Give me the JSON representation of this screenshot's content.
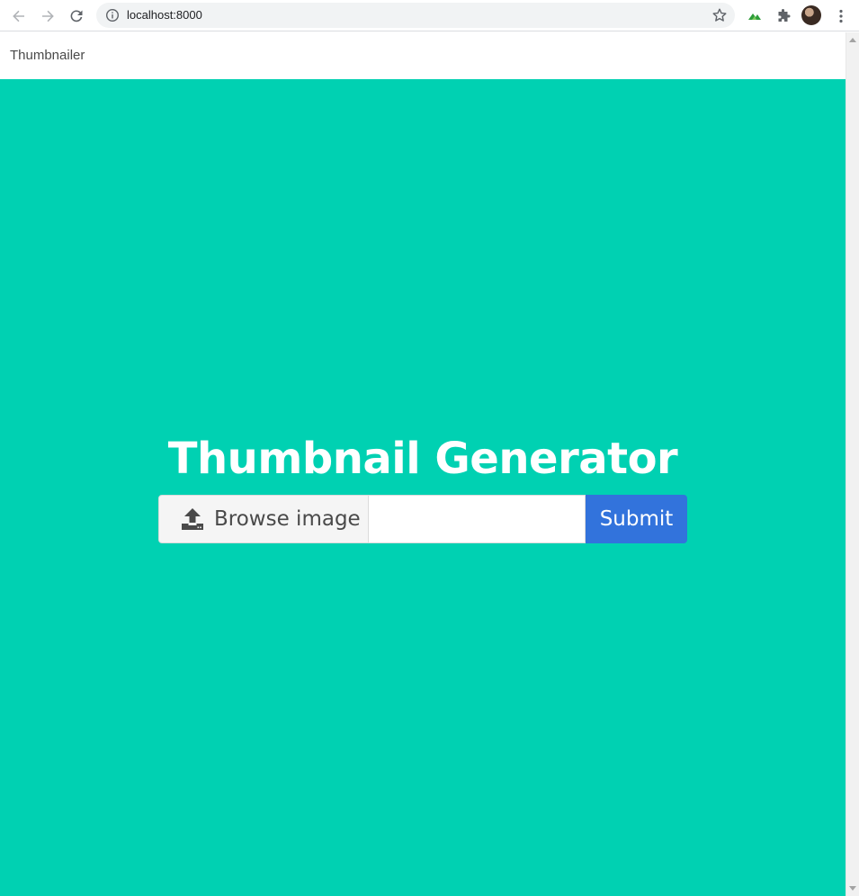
{
  "browser": {
    "url": "localhost:8000",
    "icons": [
      "back-arrow-icon",
      "forward-arrow-icon",
      "reload-icon",
      "info-icon",
      "star-icon",
      "extension-icon",
      "puzzle-icon",
      "profile-avatar",
      "menu-dots-icon"
    ]
  },
  "navbar": {
    "brand": "Thumbnailer"
  },
  "hero": {
    "title": "Thumbnail Generator"
  },
  "upload": {
    "browse_label": "Browse image",
    "file_name": "",
    "submit_label": "Submit"
  },
  "colors": {
    "hero_bg": "#00d1b2",
    "submit_bg": "#3273dc",
    "file_cta_bg": "#f5f5f5"
  }
}
